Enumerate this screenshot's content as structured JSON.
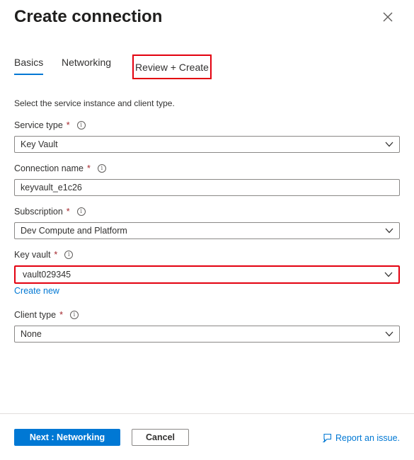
{
  "dialog": {
    "title": "Create connection",
    "close_icon": "close-icon"
  },
  "tabs": [
    {
      "label": "Basics",
      "active": true
    },
    {
      "label": "Networking",
      "active": false
    },
    {
      "label": "Review + Create",
      "active": false
    }
  ],
  "description": "Select the service instance and client type.",
  "fields": {
    "service_type": {
      "label": "Service type",
      "required_mark": "*",
      "value": "Key Vault"
    },
    "connection_name": {
      "label": "Connection name",
      "required_mark": "*",
      "value": "keyvault_e1c26"
    },
    "subscription": {
      "label": "Subscription",
      "required_mark": "*",
      "value": "Dev Compute and Platform"
    },
    "key_vault": {
      "label": "Key vault",
      "required_mark": "*",
      "value": "vault029345",
      "create_new_link": "Create new"
    },
    "client_type": {
      "label": "Client type",
      "required_mark": "*",
      "value": "None"
    }
  },
  "footer": {
    "next_label": "Next : Networking",
    "cancel_label": "Cancel",
    "report_label": "Report an issue."
  },
  "colors": {
    "accent": "#0078d4",
    "highlight": "#e3000f",
    "required": "#a4262c"
  }
}
